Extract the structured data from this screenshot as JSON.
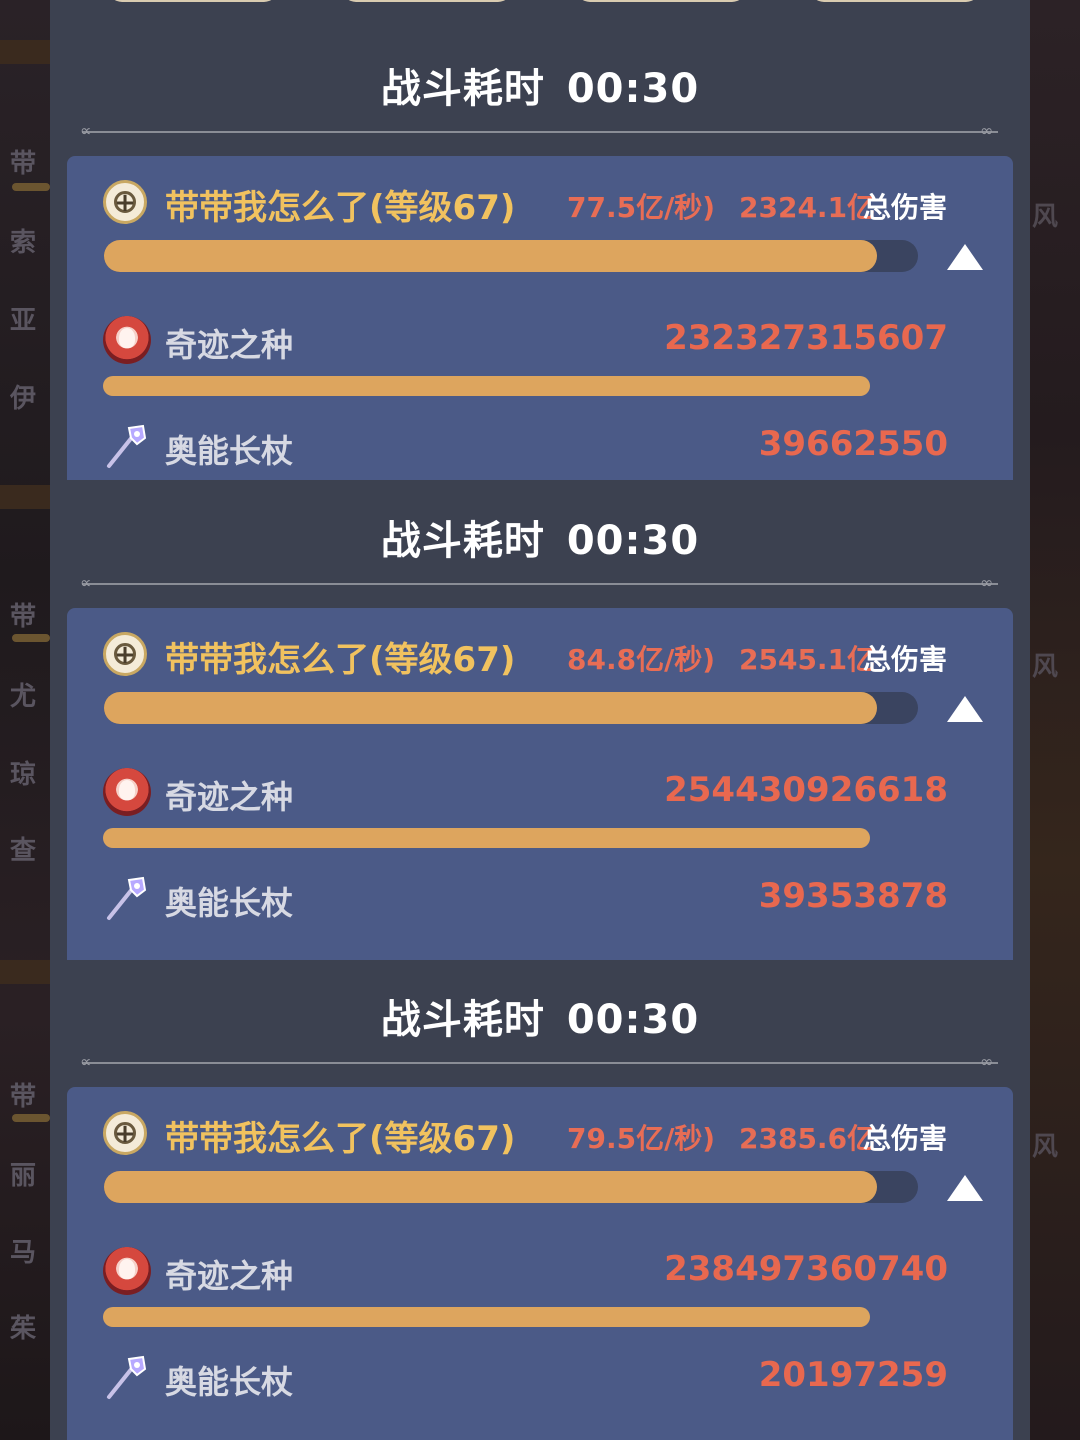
{
  "battle_time_label": "战斗耗时",
  "total_damage_label": "总伤害",
  "records": [
    {
      "time": "00:30",
      "player": "带带我怎么了(等级67)",
      "dps": "77.5亿/秒)",
      "total": "2324.1亿",
      "total_fill": 0.95,
      "items": [
        {
          "name": "奇迹之种",
          "value": "232327315607",
          "icon": "seed-avatar-icon",
          "fill": 0.99
        },
        {
          "name": "奥能长杖",
          "value": "39662550",
          "icon": "arcane-staff-icon"
        }
      ]
    },
    {
      "time": "00:30",
      "player": "带带我怎么了(等级67)",
      "dps": "84.8亿/秒)",
      "total": "2545.1亿",
      "total_fill": 0.95,
      "items": [
        {
          "name": "奇迹之种",
          "value": "254430926618",
          "icon": "seed-avatar-icon",
          "fill": 0.99
        },
        {
          "name": "奥能长杖",
          "value": "39353878",
          "icon": "arcane-staff-icon"
        }
      ]
    },
    {
      "time": "00:30",
      "player": "带带我怎么了(等级67)",
      "dps": "79.5亿/秒)",
      "total": "2385.6亿",
      "total_fill": 0.95,
      "items": [
        {
          "name": "奇迹之种",
          "value": "238497360740",
          "icon": "seed-avatar-icon",
          "fill": 0.99
        },
        {
          "name": "奥能长杖",
          "value": "20197259",
          "icon": "arcane-staff-icon"
        }
      ]
    }
  ],
  "background_left_names": [
    "带",
    "索",
    "亚",
    "伊",
    "带",
    "尤",
    "琼",
    "查",
    "带",
    "丽",
    "马",
    "茱"
  ],
  "background_right_names": [
    "风",
    "风",
    "风"
  ],
  "colors": {
    "panel": "#3c4150",
    "card": "#4b5a87",
    "bar_fill": "#dda55e",
    "player_name": "#f1c25f",
    "damage_value": "#e8684f"
  }
}
